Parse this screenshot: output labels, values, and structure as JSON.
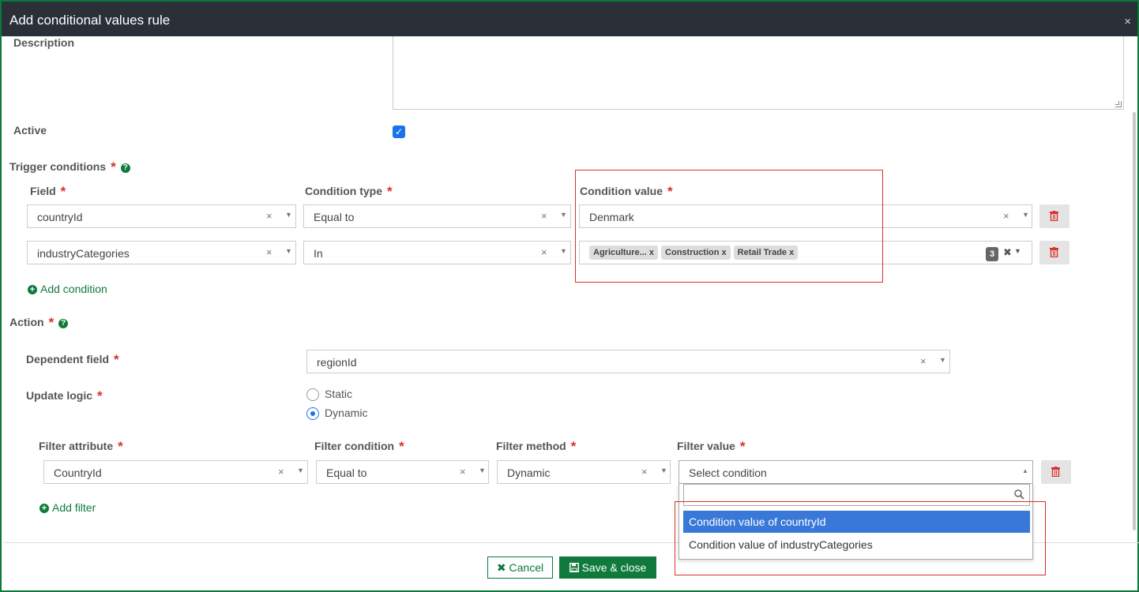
{
  "dialog": {
    "title": "Add conditional values rule",
    "close_glyph": "×"
  },
  "description": {
    "label": "Description",
    "value": ""
  },
  "active": {
    "label": "Active",
    "checked": true
  },
  "trigger": {
    "label": "Trigger conditions",
    "headers": {
      "field": "Field",
      "condition_type": "Condition type",
      "condition_value": "Condition value"
    },
    "rows": [
      {
        "field": "countryId",
        "condition_type": "Equal to",
        "condition_value": "Denmark"
      },
      {
        "field": "industryCategories",
        "condition_type": "In",
        "tags": [
          "Agriculture...",
          "Construction",
          "Retail Trade"
        ],
        "count": "3"
      }
    ],
    "add_condition": "Add condition"
  },
  "action": {
    "label": "Action",
    "dependent_field": {
      "label": "Dependent field",
      "value": "regionId"
    },
    "update_logic": {
      "label": "Update logic",
      "options": [
        "Static",
        "Dynamic"
      ],
      "selected": "Dynamic"
    },
    "filter_headers": {
      "attribute": "Filter attribute",
      "condition": "Filter condition",
      "method": "Filter method",
      "value": "Filter value"
    },
    "filter_row": {
      "attribute": "CountryId",
      "condition": "Equal to",
      "method": "Dynamic",
      "value_placeholder": "Select condition"
    },
    "dropdown_options": [
      "Condition value of countryId",
      "Condition value of industryCategories"
    ],
    "add_filter": "Add filter"
  },
  "footer": {
    "cancel": "Cancel",
    "save": "Save & close"
  },
  "colors": {
    "accent": "#0f7a3b",
    "required": "#d9302a",
    "highlight": "#3a78d8",
    "titlebar": "#2b2f38"
  }
}
